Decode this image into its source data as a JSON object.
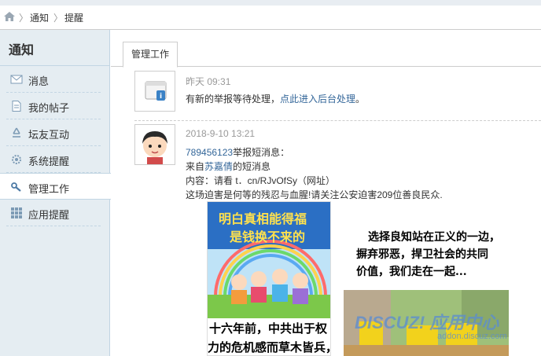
{
  "breadcrumb": {
    "level1": "通知",
    "level2": "提醒",
    "separator": "〉"
  },
  "sidebar": {
    "title": "通知",
    "items": [
      {
        "label": "消息",
        "icon": "envelope-icon"
      },
      {
        "label": "我的帖子",
        "icon": "document-icon"
      },
      {
        "label": "坛友互动",
        "icon": "recycle-icon"
      },
      {
        "label": "系统提醒",
        "icon": "gear-icon"
      },
      {
        "label": "管理工作",
        "icon": "wrench-icon",
        "active": true
      },
      {
        "label": "应用提醒",
        "icon": "grid-icon"
      }
    ]
  },
  "tabs": {
    "active_label": "管理工作"
  },
  "notices": [
    {
      "time": "昨天 09:31",
      "text_before": "有新的举报等待处理，",
      "link": "点此进入后台处理",
      "text_after": "。"
    },
    {
      "time": "2018-9-10 13:21",
      "line1_link": "789456123",
      "line1_text": "举报短消息：",
      "line2_before": "来自",
      "line2_link": "苏嘉倩",
      "line2_after": "的短消息",
      "line3": "内容：请看 t．cn/RJvOfSy（网址）",
      "line4": "这场迫害是何等的残忍与血腥!请关注公安迫害209位善良民众."
    }
  ],
  "image1": {
    "title_line1": "明白真相能得福",
    "title_line2": "是钱换不来的",
    "caption_line1": "十六年前，中共出于权",
    "caption_line2": "力的危机感而草木皆兵，"
  },
  "image2": {
    "line1": "选择良知站在正义的一边，",
    "line2": "摒弃邪恶，捍卫社会的共同",
    "line3": "价值，我们走在一起..."
  },
  "watermark": {
    "brand": "DISCUZ! 应用中心",
    "url": "addon.discuz.com"
  }
}
